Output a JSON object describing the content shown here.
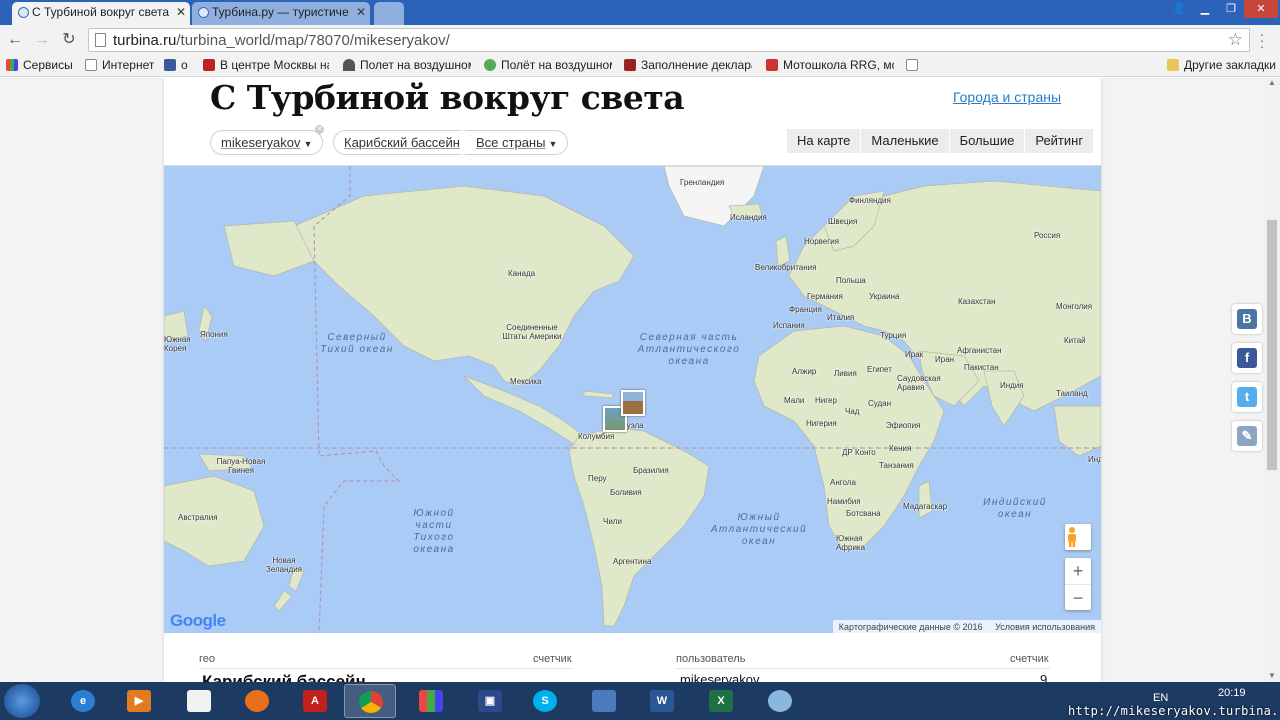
{
  "browser": {
    "tabs": [
      {
        "title": "С Турбиной вокруг света",
        "active": true
      },
      {
        "title": "Турбина.ру — туристиче",
        "active": false
      }
    ],
    "url_host": "turbina.ru",
    "url_path": "/turbina_world/map/78070/mikeseryakov/",
    "bookmarks": [
      {
        "label": "Сервисы",
        "icon": "apps-icon"
      },
      {
        "label": "Интернет",
        "icon": "page-icon"
      },
      {
        "label": "о",
        "icon": "facebook-icon"
      },
      {
        "label": "В центре Москвы на",
        "icon": "news-icon"
      },
      {
        "label": "Полет на воздушном",
        "icon": "parachute-icon"
      },
      {
        "label": "Полёт на воздушном",
        "icon": "green-g-icon"
      },
      {
        "label": "Заполнение деклара",
        "icon": "declaration-icon"
      },
      {
        "label": "Мотошкола RRG, мот",
        "icon": "moto-icon"
      },
      {
        "label": "",
        "icon": "page-icon"
      }
    ],
    "other_bookmarks": "Другие закладки"
  },
  "site": {
    "title": "С Турбиной вокруг света",
    "cities_link": "Города и страны",
    "filters": {
      "user": "mikeseryakov",
      "region": "Карибский бассейн",
      "countries": "Все страны"
    },
    "view_tabs": [
      "На карте",
      "Маленькие",
      "Большие",
      "Рейтинг"
    ]
  },
  "map": {
    "country_labels": [
      {
        "text": "Гренландия"
      },
      {
        "text": "Исландия"
      },
      {
        "text": "Финляндия"
      },
      {
        "text": "Швеция"
      },
      {
        "text": "Норвегия"
      },
      {
        "text": "Россия"
      },
      {
        "text": "Великобритания"
      },
      {
        "text": "Польша"
      },
      {
        "text": "Германия"
      },
      {
        "text": "Украина"
      },
      {
        "text": "Франция"
      },
      {
        "text": "Италия"
      },
      {
        "text": "Испания"
      },
      {
        "text": "Казахстан"
      },
      {
        "text": "Монголия"
      },
      {
        "text": "Турция"
      },
      {
        "text": "Китай"
      },
      {
        "text": "Ирак"
      },
      {
        "text": "Иран"
      },
      {
        "text": "Афганистан"
      },
      {
        "text": "Пакистан"
      },
      {
        "text": "Индия"
      },
      {
        "text": "Таиланд"
      },
      {
        "text": "Саудовская Аравия"
      },
      {
        "text": "Египет"
      },
      {
        "text": "Ливия"
      },
      {
        "text": "Алжир"
      },
      {
        "text": "Мали"
      },
      {
        "text": "Нигер"
      },
      {
        "text": "Чад"
      },
      {
        "text": "Судан"
      },
      {
        "text": "Нигерия"
      },
      {
        "text": "Эфиопия"
      },
      {
        "text": "ДР Конго"
      },
      {
        "text": "Кения"
      },
      {
        "text": "Танзания"
      },
      {
        "text": "Ангола"
      },
      {
        "text": "Намибия"
      },
      {
        "text": "Ботсвана"
      },
      {
        "text": "Мадагаскар"
      },
      {
        "text": "Южная Африка"
      },
      {
        "text": "Канада"
      },
      {
        "text": "Соединенные Штаты Америки"
      },
      {
        "text": "Мексика"
      },
      {
        "text": "Венесуэла"
      },
      {
        "text": "Колумбия"
      },
      {
        "text": "Перу"
      },
      {
        "text": "Бразилия"
      },
      {
        "text": "Боливия"
      },
      {
        "text": "Чили"
      },
      {
        "text": "Аргентина"
      },
      {
        "text": "Япония"
      },
      {
        "text": "Южная Корея"
      },
      {
        "text": "Папуа-Новая Гвинея"
      },
      {
        "text": "Австралия"
      },
      {
        "text": "Новая Зеландия"
      },
      {
        "text": "Инд"
      }
    ],
    "ocean_labels": [
      {
        "text": "Северный Тихий океан"
      },
      {
        "text": "Северная часть Атлантического океана"
      },
      {
        "text": "Южный Атлантический океан"
      },
      {
        "text": "Индийский океан"
      },
      {
        "text": "Южной части Тихого океана"
      }
    ],
    "google": "Google",
    "attribution": "Картографические данные © 2016",
    "terms": "Условия использования"
  },
  "table": {
    "col1": "гео",
    "col2": "счетчик",
    "col3": "пользователь",
    "col4": "счетчик",
    "row_partial_left": "Карибский бассейн",
    "row_partial_user": "mikeseryakov",
    "row_partial_count": "9"
  },
  "social": [
    "vk-icon",
    "facebook-icon",
    "twitter-icon",
    "livejournal-icon"
  ],
  "taskbar": {
    "lang": "EN",
    "time": "20:19",
    "watermark": "http://mikeseryakov.turbina.ru"
  }
}
